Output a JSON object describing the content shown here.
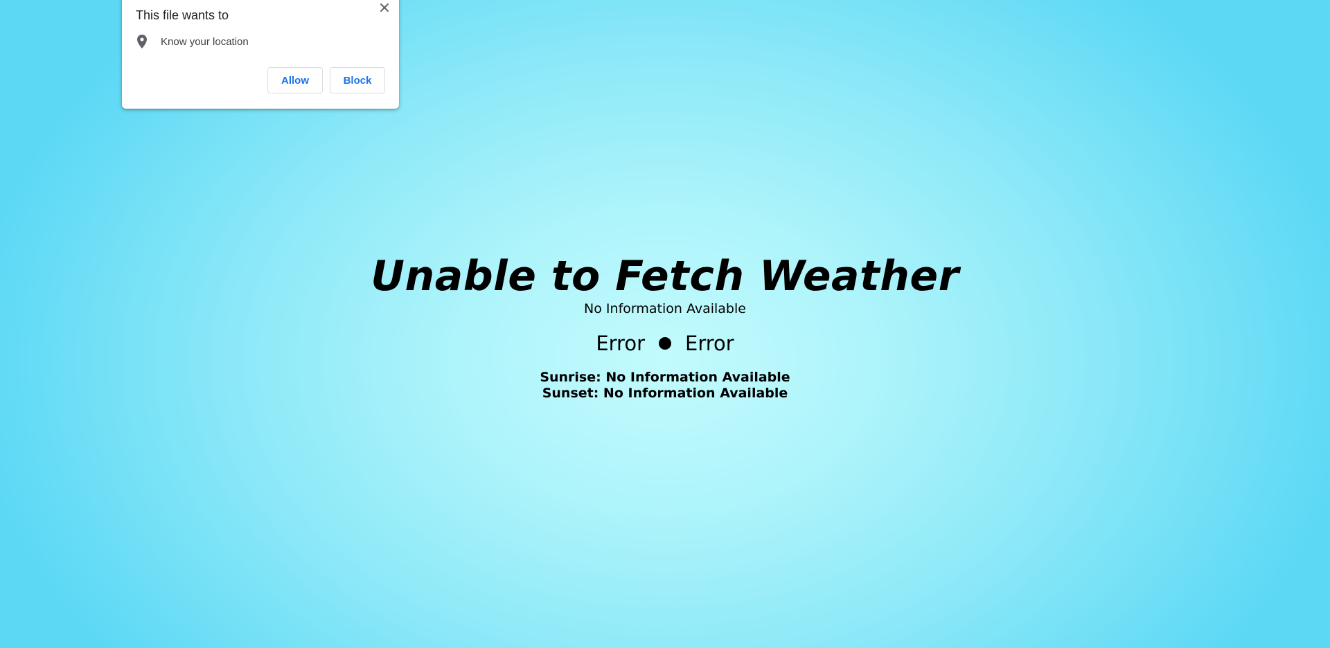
{
  "permission_popup": {
    "title": "This file wants to",
    "request_icon": "location-pin-icon",
    "request_text": "Know your location",
    "close_icon": "close-icon",
    "allow_label": "Allow",
    "block_label": "Block",
    "button_color": "#1a73e8"
  },
  "weather": {
    "title": "Unable to Fetch Weather",
    "description": "No Information Available",
    "temperature_left": "Error",
    "temperature_right": "Error",
    "separator_icon": "dot-icon",
    "sunrise": "Sunrise: No Information Available",
    "sunset": "Sunset: No Information Available"
  },
  "colors": {
    "background_center": "#c2fbfd",
    "background_edge": "#5cd8f5"
  }
}
